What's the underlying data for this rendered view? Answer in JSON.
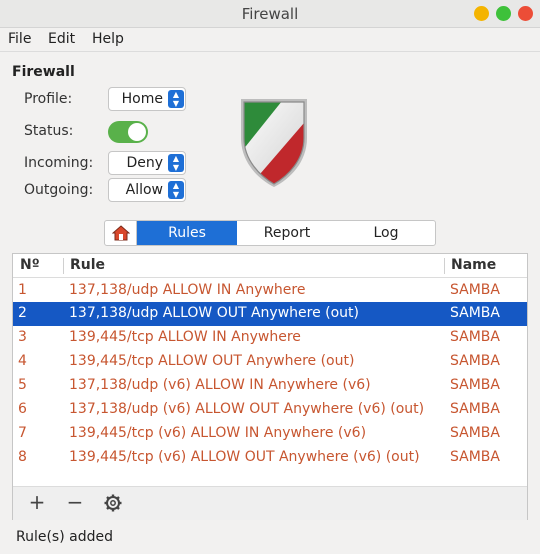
{
  "window": {
    "title": "Firewall"
  },
  "menu": {
    "file": "File",
    "edit": "Edit",
    "help": "Help"
  },
  "section_title": "Firewall",
  "profile": {
    "label": "Profile:",
    "value": "Home"
  },
  "status": {
    "label": "Status:",
    "enabled": true
  },
  "incoming": {
    "label": "Incoming:",
    "value": "Deny"
  },
  "outgoing": {
    "label": "Outgoing:",
    "value": "Allow"
  },
  "tabs": {
    "home_icon": "home-icon",
    "rules": "Rules",
    "report": "Report",
    "log": "Log",
    "active": "Rules"
  },
  "table": {
    "headers": {
      "num": "Nº",
      "rule": "Rule",
      "name": "Name"
    },
    "rows": [
      {
        "num": "1",
        "rule": "137,138/udp ALLOW IN Anywhere",
        "name": "SAMBA"
      },
      {
        "num": "2",
        "rule": "137,138/udp ALLOW OUT Anywhere (out)",
        "name": "SAMBA"
      },
      {
        "num": "3",
        "rule": "139,445/tcp ALLOW IN Anywhere",
        "name": "SAMBA"
      },
      {
        "num": "4",
        "rule": "139,445/tcp ALLOW OUT Anywhere (out)",
        "name": "SAMBA"
      },
      {
        "num": "5",
        "rule": "137,138/udp (v6) ALLOW IN Anywhere (v6)",
        "name": "SAMBA"
      },
      {
        "num": "6",
        "rule": "137,138/udp (v6) ALLOW OUT Anywhere (v6) (out)",
        "name": "SAMBA"
      },
      {
        "num": "7",
        "rule": "139,445/tcp (v6) ALLOW IN Anywhere (v6)",
        "name": "SAMBA"
      },
      {
        "num": "8",
        "rule": "139,445/tcp (v6) ALLOW OUT Anywhere (v6) (out)",
        "name": "SAMBA"
      }
    ],
    "selected_row": 2
  },
  "toolbar": {
    "add": "+",
    "remove": "−",
    "settings_icon": "gear-icon"
  },
  "status_bar": "Rule(s) added",
  "colors": {
    "accent": "#1e6fd6",
    "selected_row": "#1558c4",
    "rule_text": "#c75630",
    "toggle_on": "#59b14a"
  }
}
